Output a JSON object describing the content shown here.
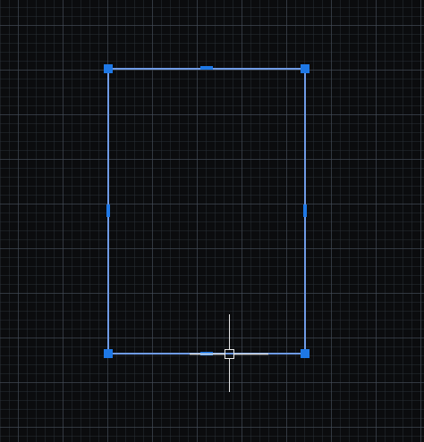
{
  "app": {
    "view": "model-space-canvas"
  },
  "colors": {
    "background": "#0b0c0e",
    "grid_major": "#464e5a",
    "grid_minor": "#2d323a",
    "selection_line": "#6f9be6",
    "grip_fill": "#1e78e6",
    "crosshair": "#e6e6e6"
  },
  "selection": {
    "object": "rectangle",
    "state": "selected",
    "grips": [
      {
        "name": "corner-top-left",
        "type": "corner"
      },
      {
        "name": "corner-top-right",
        "type": "corner"
      },
      {
        "name": "corner-bottom-left",
        "type": "corner"
      },
      {
        "name": "corner-bottom-right",
        "type": "corner"
      },
      {
        "name": "midpoint-top",
        "type": "midpoint"
      },
      {
        "name": "midpoint-left",
        "type": "midpoint"
      },
      {
        "name": "midpoint-right",
        "type": "midpoint"
      },
      {
        "name": "midpoint-bottom",
        "type": "midpoint"
      }
    ]
  },
  "cursor": {
    "icon": "crosshair-pickbox-icon"
  }
}
